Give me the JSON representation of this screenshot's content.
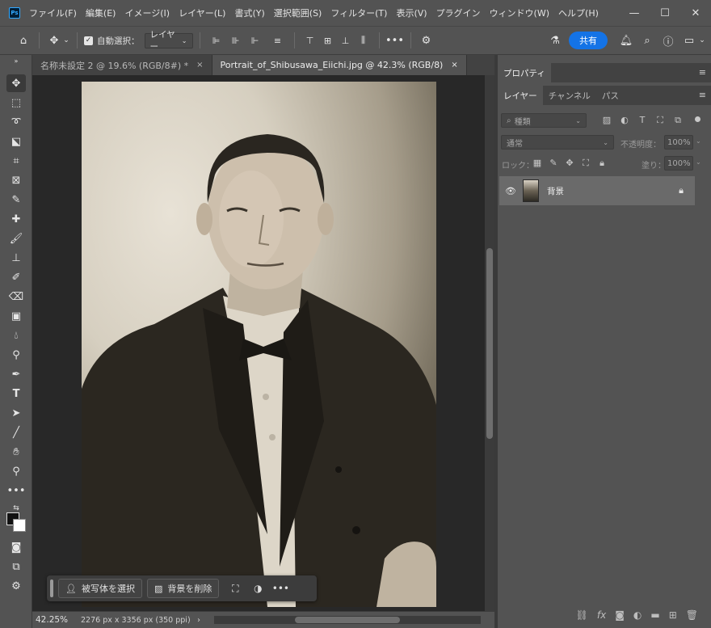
{
  "app": {
    "logo": "Ps"
  },
  "menu": [
    "ファイル(F)",
    "編集(E)",
    "イメージ(I)",
    "レイヤー(L)",
    "書式(Y)",
    "選択範囲(S)",
    "フィルター(T)",
    "表示(V)",
    "プラグイン",
    "ウィンドウ(W)",
    "ヘルプ(H)"
  ],
  "window": {
    "minimize": "—",
    "maximize": "☐",
    "close": "✕"
  },
  "options": {
    "auto_select_label": "自動選択：",
    "auto_select_checked": "✓",
    "target_dropdown": "レイヤー",
    "share_label": "共有",
    "more": "•••"
  },
  "tabs": [
    {
      "label": "名称未設定 2 @ 19.6% (RGB/8#) *",
      "close": "×"
    },
    {
      "label": "Portrait_of_Shibusawa_Eiichi.jpg @ 42.3% (RGB/8)",
      "close": "×"
    }
  ],
  "taskbar": {
    "select_subject": "被写体を選択",
    "remove_bg": "背景を削除",
    "more": "•••"
  },
  "status": {
    "zoom": "42.25%",
    "doc_info": "2276 px x 3356 px (350 ppi)",
    "arrow": "›"
  },
  "properties_tab": "プロパティ",
  "layers_panel": {
    "tabs": [
      "レイヤー",
      "チャンネル",
      "パス"
    ],
    "filter_placeholder": "種類",
    "blend_mode": "通常",
    "opacity_label": "不透明度：",
    "opacity_value": "100%",
    "lock_label": "ロック：",
    "fill_label": "塗り：",
    "fill_value": "100%",
    "layer_name": "背景"
  },
  "colors": {
    "accent": "#1473e6",
    "bg": "#535353",
    "canvas": "#282828"
  }
}
